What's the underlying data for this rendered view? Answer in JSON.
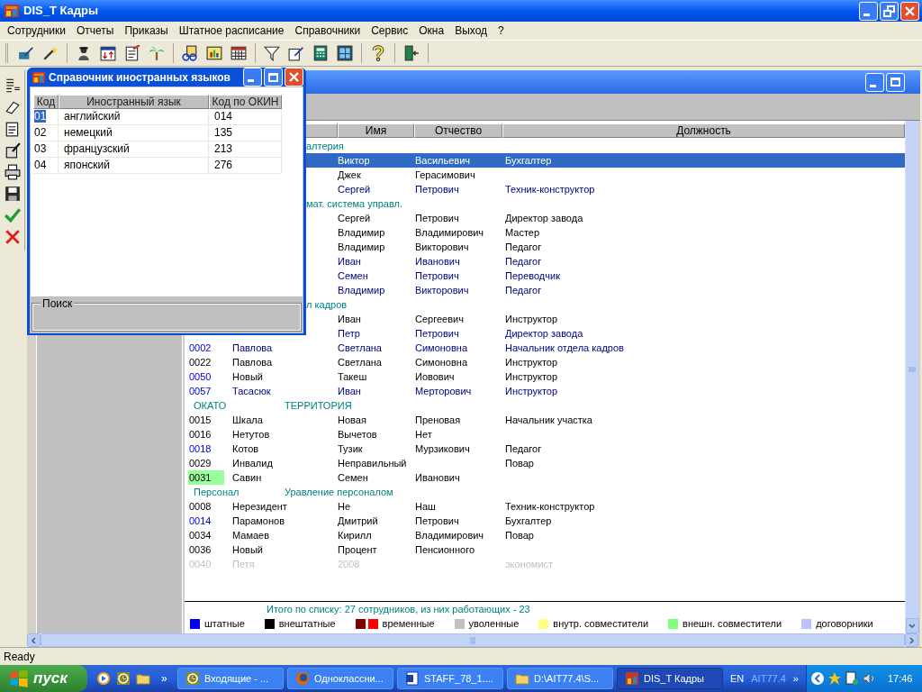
{
  "window": {
    "title": "DIS_T Кадры"
  },
  "menu": [
    "Сотрудники",
    "Отчеты",
    "Приказы",
    "Штатное расписание",
    "Справочники",
    "Сервис",
    "Окна",
    "Выход",
    "?"
  ],
  "dialog": {
    "title": "Справочник иностранных языков",
    "columns": [
      "Код",
      "Иностранный язык",
      "Код по ОКИН"
    ],
    "rows": [
      {
        "code": "01",
        "language": "английский",
        "okin": "014",
        "selected": true
      },
      {
        "code": "02",
        "language": "немецкий",
        "okin": "135",
        "selected": false
      },
      {
        "code": "03",
        "language": "французский",
        "okin": "213",
        "selected": false
      },
      {
        "code": "04",
        "language": "японский",
        "okin": "276",
        "selected": false
      }
    ],
    "search": {
      "label": "Поиск"
    }
  },
  "list": {
    "columns": [
      "Имя",
      "Отчество",
      "Должность"
    ],
    "rows": [
      {
        "kind": "group",
        "name": "алтерия"
      },
      {
        "kind": "person",
        "name": "Виктор",
        "patronymic": "Васильевич",
        "position": "Бухгалтер",
        "selected": true
      },
      {
        "kind": "person",
        "name": "Джек",
        "patronymic": "Герасимович",
        "staff": false,
        "dismissed": false,
        "selected": false
      },
      {
        "kind": "person",
        "name": "Сергей",
        "patronymic": "Петрович",
        "position": "Техник-конструктор",
        "staff": true,
        "dismissed": false,
        "selected": false
      },
      {
        "kind": "group",
        "name": "мат. система управл."
      },
      {
        "kind": "person",
        "name": "Сергей",
        "patronymic": "Петрович",
        "position": "Директор завода",
        "staff": false,
        "dismissed": false,
        "selected": false
      },
      {
        "kind": "person",
        "name": "Владимир",
        "patronymic": "Владимирович",
        "position": "Мастер",
        "staff": false,
        "dismissed": false,
        "selected": false
      },
      {
        "kind": "person",
        "name": "Владимир",
        "patronymic": "Викторович",
        "position": "Педагог",
        "staff": false,
        "dismissed": false,
        "selected": false
      },
      {
        "kind": "person",
        "name": "Иван",
        "patronymic": "Иванович",
        "position": "Педагог",
        "staff": true,
        "dismissed": false,
        "selected": false
      },
      {
        "kind": "person",
        "name": "Семен",
        "patronymic": "Петрович",
        "position": "Переводчик",
        "staff": true,
        "dismissed": false,
        "selected": false
      },
      {
        "kind": "person",
        "name": "Владимир",
        "patronymic": "Викторович",
        "position": "Педагог",
        "staff": true,
        "dismissed": false,
        "selected": false
      },
      {
        "kind": "group",
        "name": "л кадров"
      },
      {
        "kind": "person",
        "name": "Иван",
        "patronymic": "Сергеевич",
        "position": "Инструктор",
        "staff": false,
        "dismissed": false,
        "selected": false
      },
      {
        "kind": "person",
        "name": "Петр",
        "patronymic": "Петрович",
        "position": "Директор завода",
        "staff": true,
        "dismissed": false,
        "selected": false
      },
      {
        "kind": "person",
        "code": {
          "text": "0002",
          "staff": true,
          "dismissed": false,
          "highlighted": false
        },
        "surname": "Павлова",
        "name": "Светлана",
        "patronymic": "Симоновна",
        "position": "Начальник отдела кадров",
        "staff": true,
        "dismissed": false,
        "selected": false
      },
      {
        "kind": "person",
        "code": {
          "text": "0022",
          "staff": false,
          "dismissed": false,
          "highlighted": false
        },
        "surname": "Павлова",
        "name": "Светлана",
        "patronymic": "Симоновна",
        "position": "Инструктор",
        "staff": false,
        "dismissed": false,
        "selected": false
      },
      {
        "kind": "person",
        "code": {
          "text": "0050",
          "staff": true,
          "dismissed": false,
          "highlighted": false
        },
        "surname": "Новый",
        "name": "Такеш",
        "patronymic": "Иовович",
        "position": "Инструктор",
        "staff": false,
        "dismissed": false,
        "selected": false
      },
      {
        "kind": "person",
        "code": {
          "text": "0057",
          "staff": true,
          "dismissed": false,
          "highlighted": false
        },
        "surname": "Тасасюк",
        "name": "Иван",
        "patronymic": "Мерторович",
        "position": "Инструктор",
        "staff": true,
        "dismissed": false,
        "selected": false
      },
      {
        "kind": "group",
        "code": "ОКАТО",
        "name": "ТЕРРИТОРИЯ"
      },
      {
        "kind": "person",
        "code": {
          "text": "0015",
          "staff": false,
          "dismissed": false,
          "highlighted": false
        },
        "surname": "Шкала",
        "name": "Новая",
        "patronymic": "Преновая",
        "position": "Начальник участка",
        "staff": false,
        "dismissed": false,
        "selected": false
      },
      {
        "kind": "person",
        "code": {
          "text": "0016",
          "staff": false,
          "dismissed": false,
          "highlighted": false
        },
        "surname": "Нетутов",
        "name": "Вычетов",
        "patronymic": "Нет",
        "staff": false,
        "dismissed": false,
        "selected": false
      },
      {
        "kind": "person",
        "code": {
          "text": "0018",
          "staff": true,
          "dismissed": false,
          "highlighted": false
        },
        "surname": "Котов",
        "name": "Тузик",
        "patronymic": "Мурзикович",
        "position": "Педагог",
        "staff": false,
        "dismissed": false,
        "selected": false
      },
      {
        "kind": "person",
        "code": {
          "text": "0029",
          "staff": false,
          "dismissed": false,
          "highlighted": false
        },
        "surname": "Инвалид",
        "name": "Неправильный",
        "position": "Повар",
        "staff": false,
        "dismissed": false,
        "selected": false
      },
      {
        "kind": "person",
        "code": {
          "text": "0031",
          "staff": false,
          "dismissed": false,
          "highlighted": true
        },
        "surname": "Савин",
        "name": "Семен",
        "patronymic": "Иванович",
        "staff": false,
        "dismissed": false,
        "selected": false
      },
      {
        "kind": "group",
        "code": "Персонал",
        "name": "Уравление персоналом"
      },
      {
        "kind": "person",
        "code": {
          "text": "0008",
          "staff": false,
          "dismissed": false,
          "highlighted": false
        },
        "surname": "Нерезидент",
        "name": "Не",
        "patronymic": "Наш",
        "position": "Техник-конструктор",
        "staff": false,
        "dismissed": false,
        "selected": false
      },
      {
        "kind": "person",
        "code": {
          "text": "0014",
          "staff": true,
          "dismissed": false,
          "highlighted": false
        },
        "surname": "Парамонов",
        "name": "Дмитрий",
        "patronymic": "Петрович",
        "position": "Бухгалтер",
        "staff": false,
        "dismissed": false,
        "selected": false
      },
      {
        "kind": "person",
        "code": {
          "text": "0034",
          "staff": false,
          "dismissed": false,
          "highlighted": false
        },
        "surname": "Мамаев",
        "name": "Кирилл",
        "patronymic": "Владимирович",
        "position": "Повар",
        "staff": false,
        "dismissed": false,
        "selected": false
      },
      {
        "kind": "person",
        "code": {
          "text": "0036",
          "staff": false,
          "dismissed": false,
          "highlighted": false
        },
        "surname": "Новый",
        "name": "Процент",
        "patronymic": "Пенсионного",
        "staff": false,
        "dismissed": false,
        "selected": false
      },
      {
        "kind": "person",
        "code": {
          "text": "0040",
          "dismissed": true,
          "highlighted": false
        },
        "surname": "Петя",
        "name": "2008",
        "position": "экономист",
        "dismissed": true,
        "selected": false
      }
    ],
    "summary": "Итого по списку: 27 сотрудников, из них работающих - 23",
    "legend": [
      {
        "label": "штатные",
        "swatches": [
          {
            "color": "#0000ff"
          }
        ]
      },
      {
        "label": "внештатные",
        "swatches": [
          {
            "color": "#000000"
          }
        ]
      },
      {
        "label": "временные",
        "swatches": [
          {
            "color": "#800000"
          },
          {
            "color": "#ff0000"
          }
        ]
      },
      {
        "label": "уволенные",
        "swatches": [
          {
            "color": "#c0c0c0"
          }
        ]
      },
      {
        "label": "внутр. совместители",
        "swatches": [
          {
            "color": "#ffff80"
          }
        ]
      },
      {
        "label": "внешн. совместители",
        "swatches": [
          {
            "color": "#80ff80"
          }
        ]
      },
      {
        "label": "договорники",
        "swatches": [
          {
            "color": "#c0c0ff"
          }
        ]
      }
    ]
  },
  "status_bar": "Ready",
  "taskbar": {
    "start": "пуск",
    "more": "»",
    "tasks": [
      {
        "kind": "mail",
        "label": "Входящие - ...",
        "selected": false
      },
      {
        "kind": "browser",
        "label": "Одноклассни...",
        "selected": false
      },
      {
        "kind": "document",
        "label": "STAFF_78_1....",
        "selected": false
      },
      {
        "kind": "folder",
        "label": "D:\\AIT77.4\\S...",
        "selected": false
      },
      {
        "kind": "app",
        "label": "DIS_T Кадры",
        "selected": true
      }
    ],
    "tray": {
      "language": "EN",
      "label": "AIT77.4",
      "more": "»",
      "time": "17:46"
    }
  }
}
